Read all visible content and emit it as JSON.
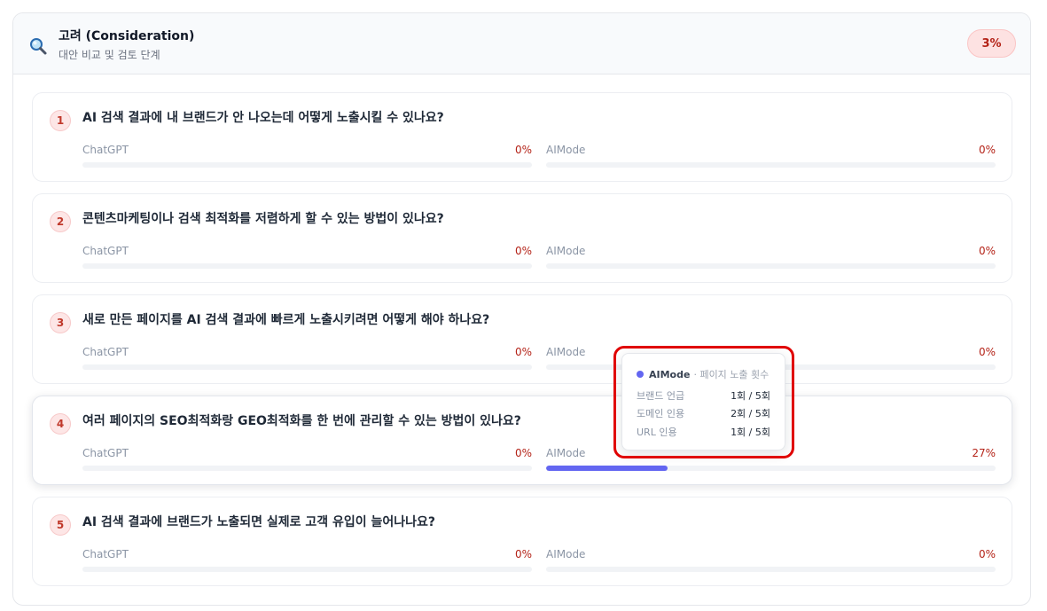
{
  "header": {
    "icon": "magnifier-icon",
    "title": "고려 (Consideration)",
    "subtitle": "대안 비교 및 검토 단계",
    "badge": "3%"
  },
  "colors": {
    "accent": "#6366f1",
    "badge_text": "#b42318",
    "badge_bg": "#fde2e2",
    "highlight": "#e00000"
  },
  "questions": [
    {
      "number": "1",
      "text": "AI 검색 결과에 내 브랜드가 안 나오는데 어떻게 노출시킬 수 있나요?",
      "chatgpt": {
        "label": "ChatGPT",
        "value": "0%",
        "fill": 0
      },
      "aimode": {
        "label": "AIMode",
        "value": "0%",
        "fill": 0
      }
    },
    {
      "number": "2",
      "text": "콘텐츠마케팅이나 검색 최적화를 저렴하게 할 수 있는 방법이 있나요?",
      "chatgpt": {
        "label": "ChatGPT",
        "value": "0%",
        "fill": 0
      },
      "aimode": {
        "label": "AIMode",
        "value": "0%",
        "fill": 0
      }
    },
    {
      "number": "3",
      "text": "새로 만든 페이지를 AI 검색 결과에 빠르게 노출시키려면 어떻게 해야 하나요?",
      "chatgpt": {
        "label": "ChatGPT",
        "value": "0%",
        "fill": 0
      },
      "aimode": {
        "label": "AIMode",
        "value": "0%",
        "fill": 0
      }
    },
    {
      "number": "4",
      "text": "여러 페이지의 SEO최적화랑 GEO최적화를 한 번에 관리할 수 있는 방법이 있나요?",
      "chatgpt": {
        "label": "ChatGPT",
        "value": "0%",
        "fill": 0
      },
      "aimode": {
        "label": "AIMode",
        "value": "27%",
        "fill": 27
      }
    },
    {
      "number": "5",
      "text": "AI 검색 결과에 브랜드가 노출되면 실제로 고객 유입이 늘어나나요?",
      "chatgpt": {
        "label": "ChatGPT",
        "value": "0%",
        "fill": 0
      },
      "aimode": {
        "label": "AIMode",
        "value": "0%",
        "fill": 0
      }
    }
  ],
  "tooltip": {
    "source": "AIMode",
    "description": "· 페이지 노출 횟수",
    "rows": [
      {
        "label": "브랜드 언급",
        "value": "1회 / 5회"
      },
      {
        "label": "도메인 인용",
        "value": "2회 / 5회"
      },
      {
        "label": "URL 인용",
        "value": "1회 / 5회"
      }
    ]
  }
}
